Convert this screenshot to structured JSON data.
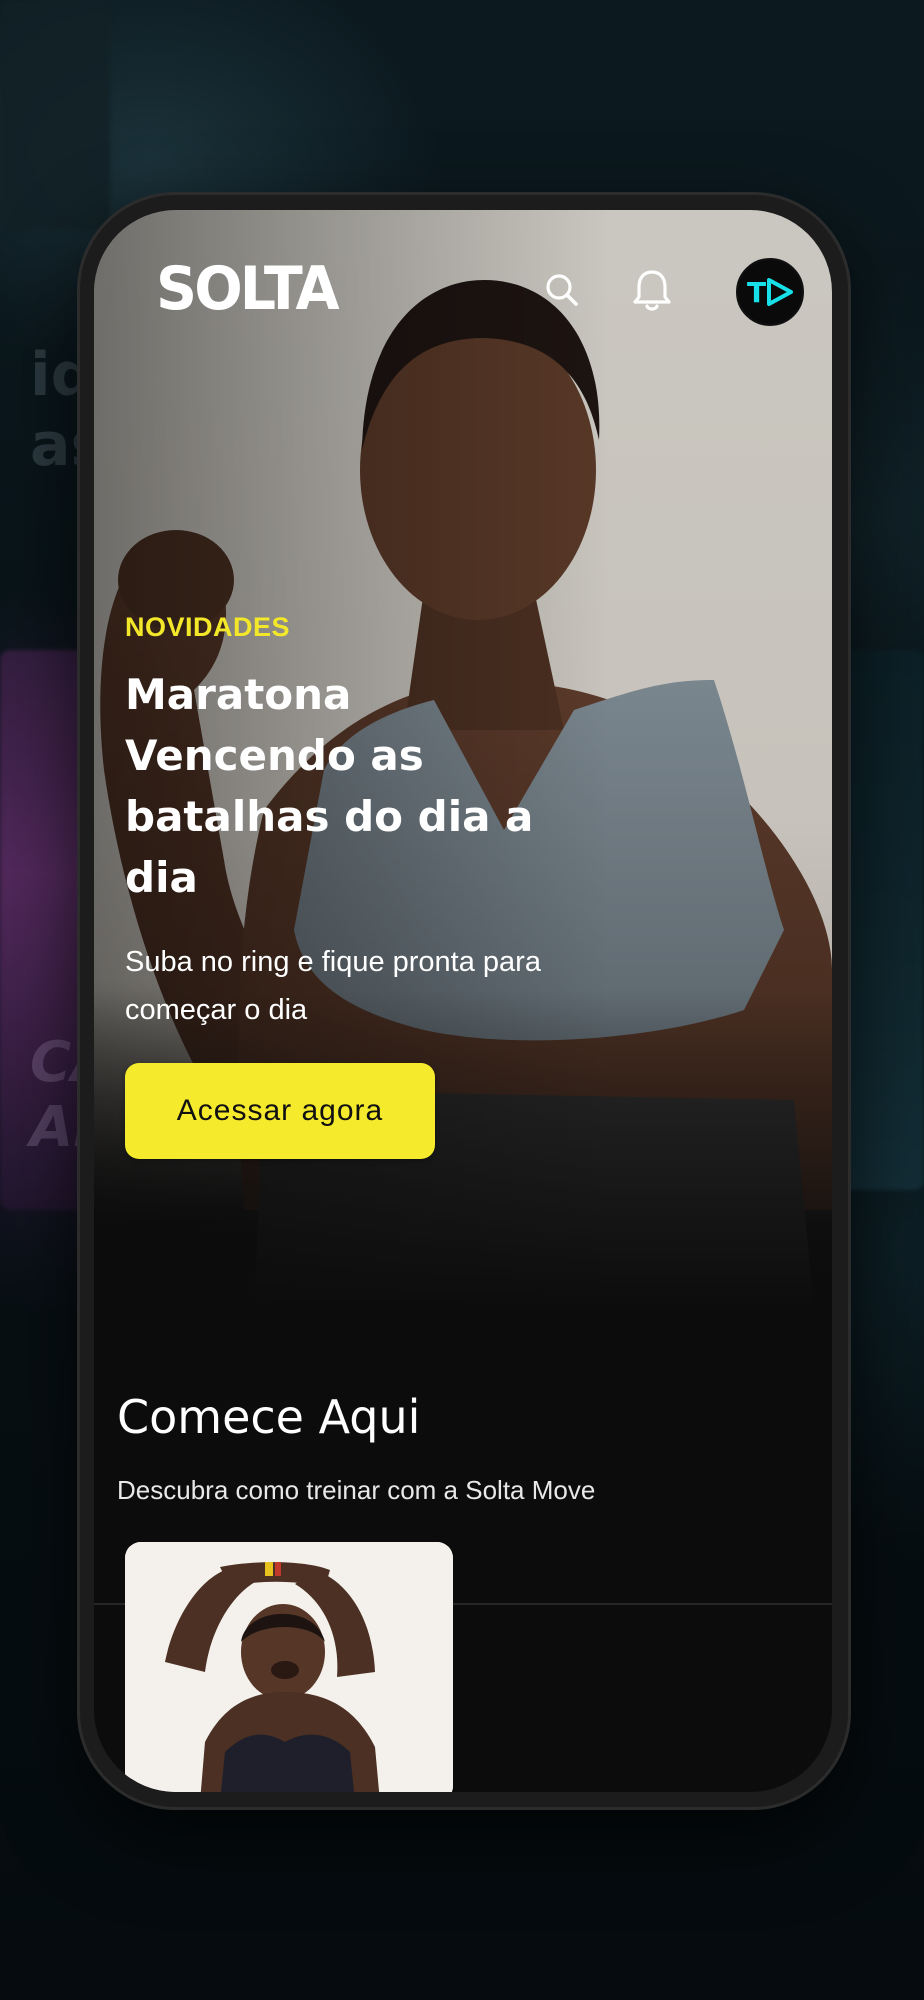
{
  "app": {
    "logo": "SOLTA"
  },
  "topbar": {
    "search_icon": "search-icon",
    "bell_icon": "bell-icon",
    "avatar_icon": "profile-avatar-icon"
  },
  "hero": {
    "kicker": "NOVIDADES",
    "title": "Maratona Vencendo as batalhas do dia a dia",
    "subtitle": "Suba no ring e fique pronta para começar o dia",
    "cta_label": "Acessar agora"
  },
  "start_section": {
    "title": "Comece Aqui",
    "subtitle": "Descubra como treinar com a Solta Move"
  },
  "colors": {
    "accent": "#f5ea2b",
    "background": "#0c0c0c",
    "avatar_accent": "#18e0e8"
  }
}
